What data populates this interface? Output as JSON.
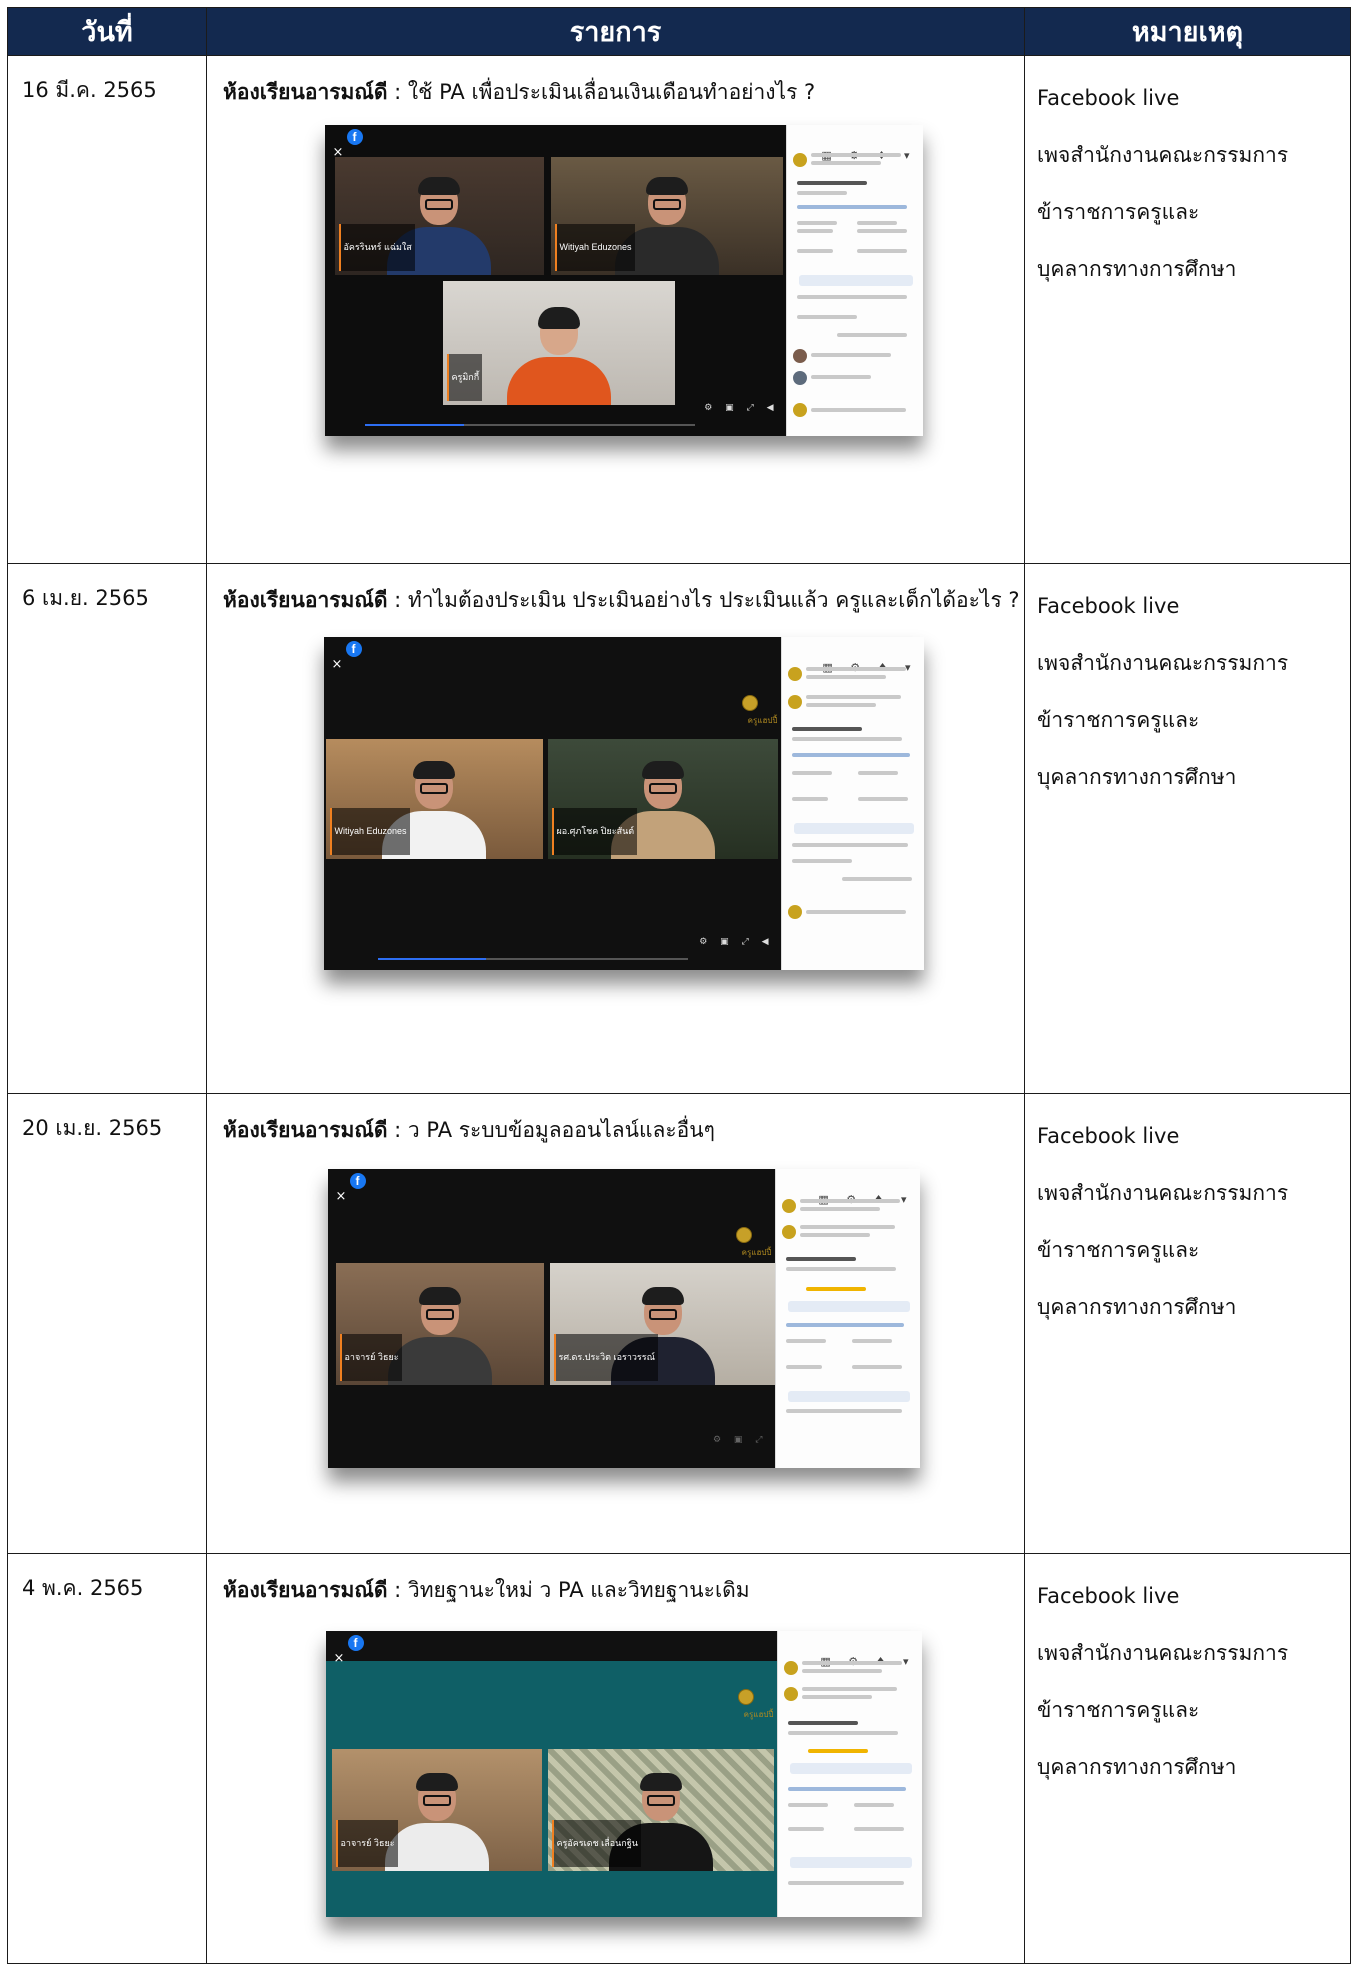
{
  "headers": {
    "date": "วันที่",
    "item": "รายการ",
    "note": "หมายเหตุ"
  },
  "rows": [
    {
      "date": "16 มี.ค. 2565",
      "prefix": "ห้องเรียนอารมณ์ดี",
      "text": " : ใช้ PA เพื่อประเมินเลื่อนเงินเดือนทำอย่างไร ?",
      "note": [
        "Facebook live",
        "เพจสำนักงานคณะกรรมการ",
        "ข้าราชการครูและ",
        "บุคลากรทางการศึกษา"
      ],
      "tiles": [
        "อัครรินทร์ แฉ่มใส",
        "Witiyah Eduzones",
        "ครูมิกกี้"
      ],
      "progress": 0.3
    },
    {
      "date": "6 เม.ย. 2565",
      "prefix": "ห้องเรียนอารมณ์ดี",
      "text": " : ทำไมต้องประเมิน ประเมินอย่างไร ประเมินแล้ว ครูและเด็กได้อะไร ?",
      "note": [
        "Facebook live",
        "เพจสำนักงานคณะกรรมการ",
        "ข้าราชการครูและ",
        "บุคลากรทางการศึกษา"
      ],
      "tiles": [
        "Witiyah Eduzones",
        "ผอ.ศุภโชค ปิยะสันต์"
      ],
      "progress": 0.35
    },
    {
      "date": "20 เม.ย. 2565",
      "prefix": "ห้องเรียนอารมณ์ดี",
      "text": " : ว PA ระบบข้อมูลออนไลน์และอื่นๆ",
      "note": [
        "Facebook live",
        "เพจสำนักงานคณะกรรมการ",
        "ข้าราชการครูและ",
        "บุคลากรทางการศึกษา"
      ],
      "tiles": [
        "อาจารย์ วิธยะ",
        "รศ.ดร.ประวิต เอราวรรณ์"
      ],
      "progress": 0
    },
    {
      "date": "4 พ.ค. 2565",
      "prefix": "ห้องเรียนอารมณ์ดี",
      "text": " : วิทยฐานะใหม่ ว PA และวิทยฐานะเดิม",
      "note": [
        "Facebook live",
        "เพจสำนักงานคณะกรรมการ",
        "ข้าราชการครูและ",
        "บุคลากรทางการศึกษา"
      ],
      "tiles": [
        "อาจารย์ วิธยะ",
        "ครูอัครเดช เลื่อนกฐิน"
      ],
      "progress": 0
    }
  ],
  "shot": {
    "close": "×",
    "fb": "f",
    "panel_icons": "▦ ⚙ ♦ ▾",
    "logo": "ครูแฮปปี้"
  },
  "colors": {
    "header_bg": "#13294f",
    "fb_blue": "#1877f2",
    "teal_bg": "#0f5f66"
  }
}
